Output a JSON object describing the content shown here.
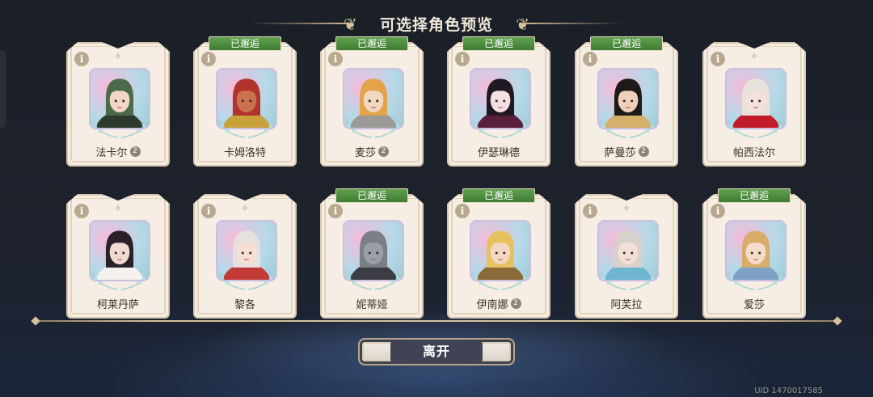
{
  "header": {
    "title": "可选择角色预览"
  },
  "tags": {
    "met": "已邂逅"
  },
  "icons": {
    "info": "i",
    "sparkle": "✦",
    "grade": "2"
  },
  "characters": [
    {
      "name": "法卡尔",
      "met": false,
      "grade": true,
      "hair": "#4a6a4a",
      "skin": "#f2d7c6",
      "accent": "#2f3b2e"
    },
    {
      "name": "卡姆洛特",
      "met": true,
      "grade": false,
      "hair": "#b2332b",
      "skin": "#c9724d",
      "accent": "#c9a13b"
    },
    {
      "name": "麦莎",
      "met": true,
      "grade": true,
      "hair": "#e3a34a",
      "skin": "#f1d6c0",
      "accent": "#9c9a96"
    },
    {
      "name": "伊瑟琳德",
      "met": true,
      "grade": false,
      "hair": "#1f1a22",
      "skin": "#f4dfe2",
      "accent": "#5b1f39"
    },
    {
      "name": "萨曼莎",
      "met": true,
      "grade": true,
      "hair": "#1d1a18",
      "skin": "#f0d0bc",
      "accent": "#d3b069"
    },
    {
      "name": "帕西法尔",
      "met": false,
      "grade": false,
      "hair": "#e9e2dc",
      "skin": "#f3e1dc",
      "accent": "#c21c2b"
    },
    {
      "name": "柯莱丹萨",
      "met": false,
      "grade": false,
      "hair": "#2a2028",
      "skin": "#f0d9d1",
      "accent": "#f4f1ee"
    },
    {
      "name": "黎各",
      "met": false,
      "grade": false,
      "hair": "#e6e1de",
      "skin": "#f6dfd2",
      "accent": "#c23a35"
    },
    {
      "name": "妮蒂娅",
      "met": true,
      "grade": false,
      "hair": "#7b7e84",
      "skin": "#9a9ea6",
      "accent": "#3b3d42"
    },
    {
      "name": "伊南娜",
      "met": true,
      "grade": true,
      "hair": "#e6c25e",
      "skin": "#f3d7c0",
      "accent": "#8b6a3a"
    },
    {
      "name": "阿芙拉",
      "met": false,
      "grade": false,
      "hair": "#d9d2cb",
      "skin": "#f2e0d8",
      "accent": "#6fb6d1"
    },
    {
      "name": "爱莎",
      "met": true,
      "grade": false,
      "hair": "#d7ad69",
      "skin": "#f4dccb",
      "accent": "#7da2c6"
    }
  ],
  "footer": {
    "leave_button": "离开",
    "uid": "UID 1470017585"
  }
}
